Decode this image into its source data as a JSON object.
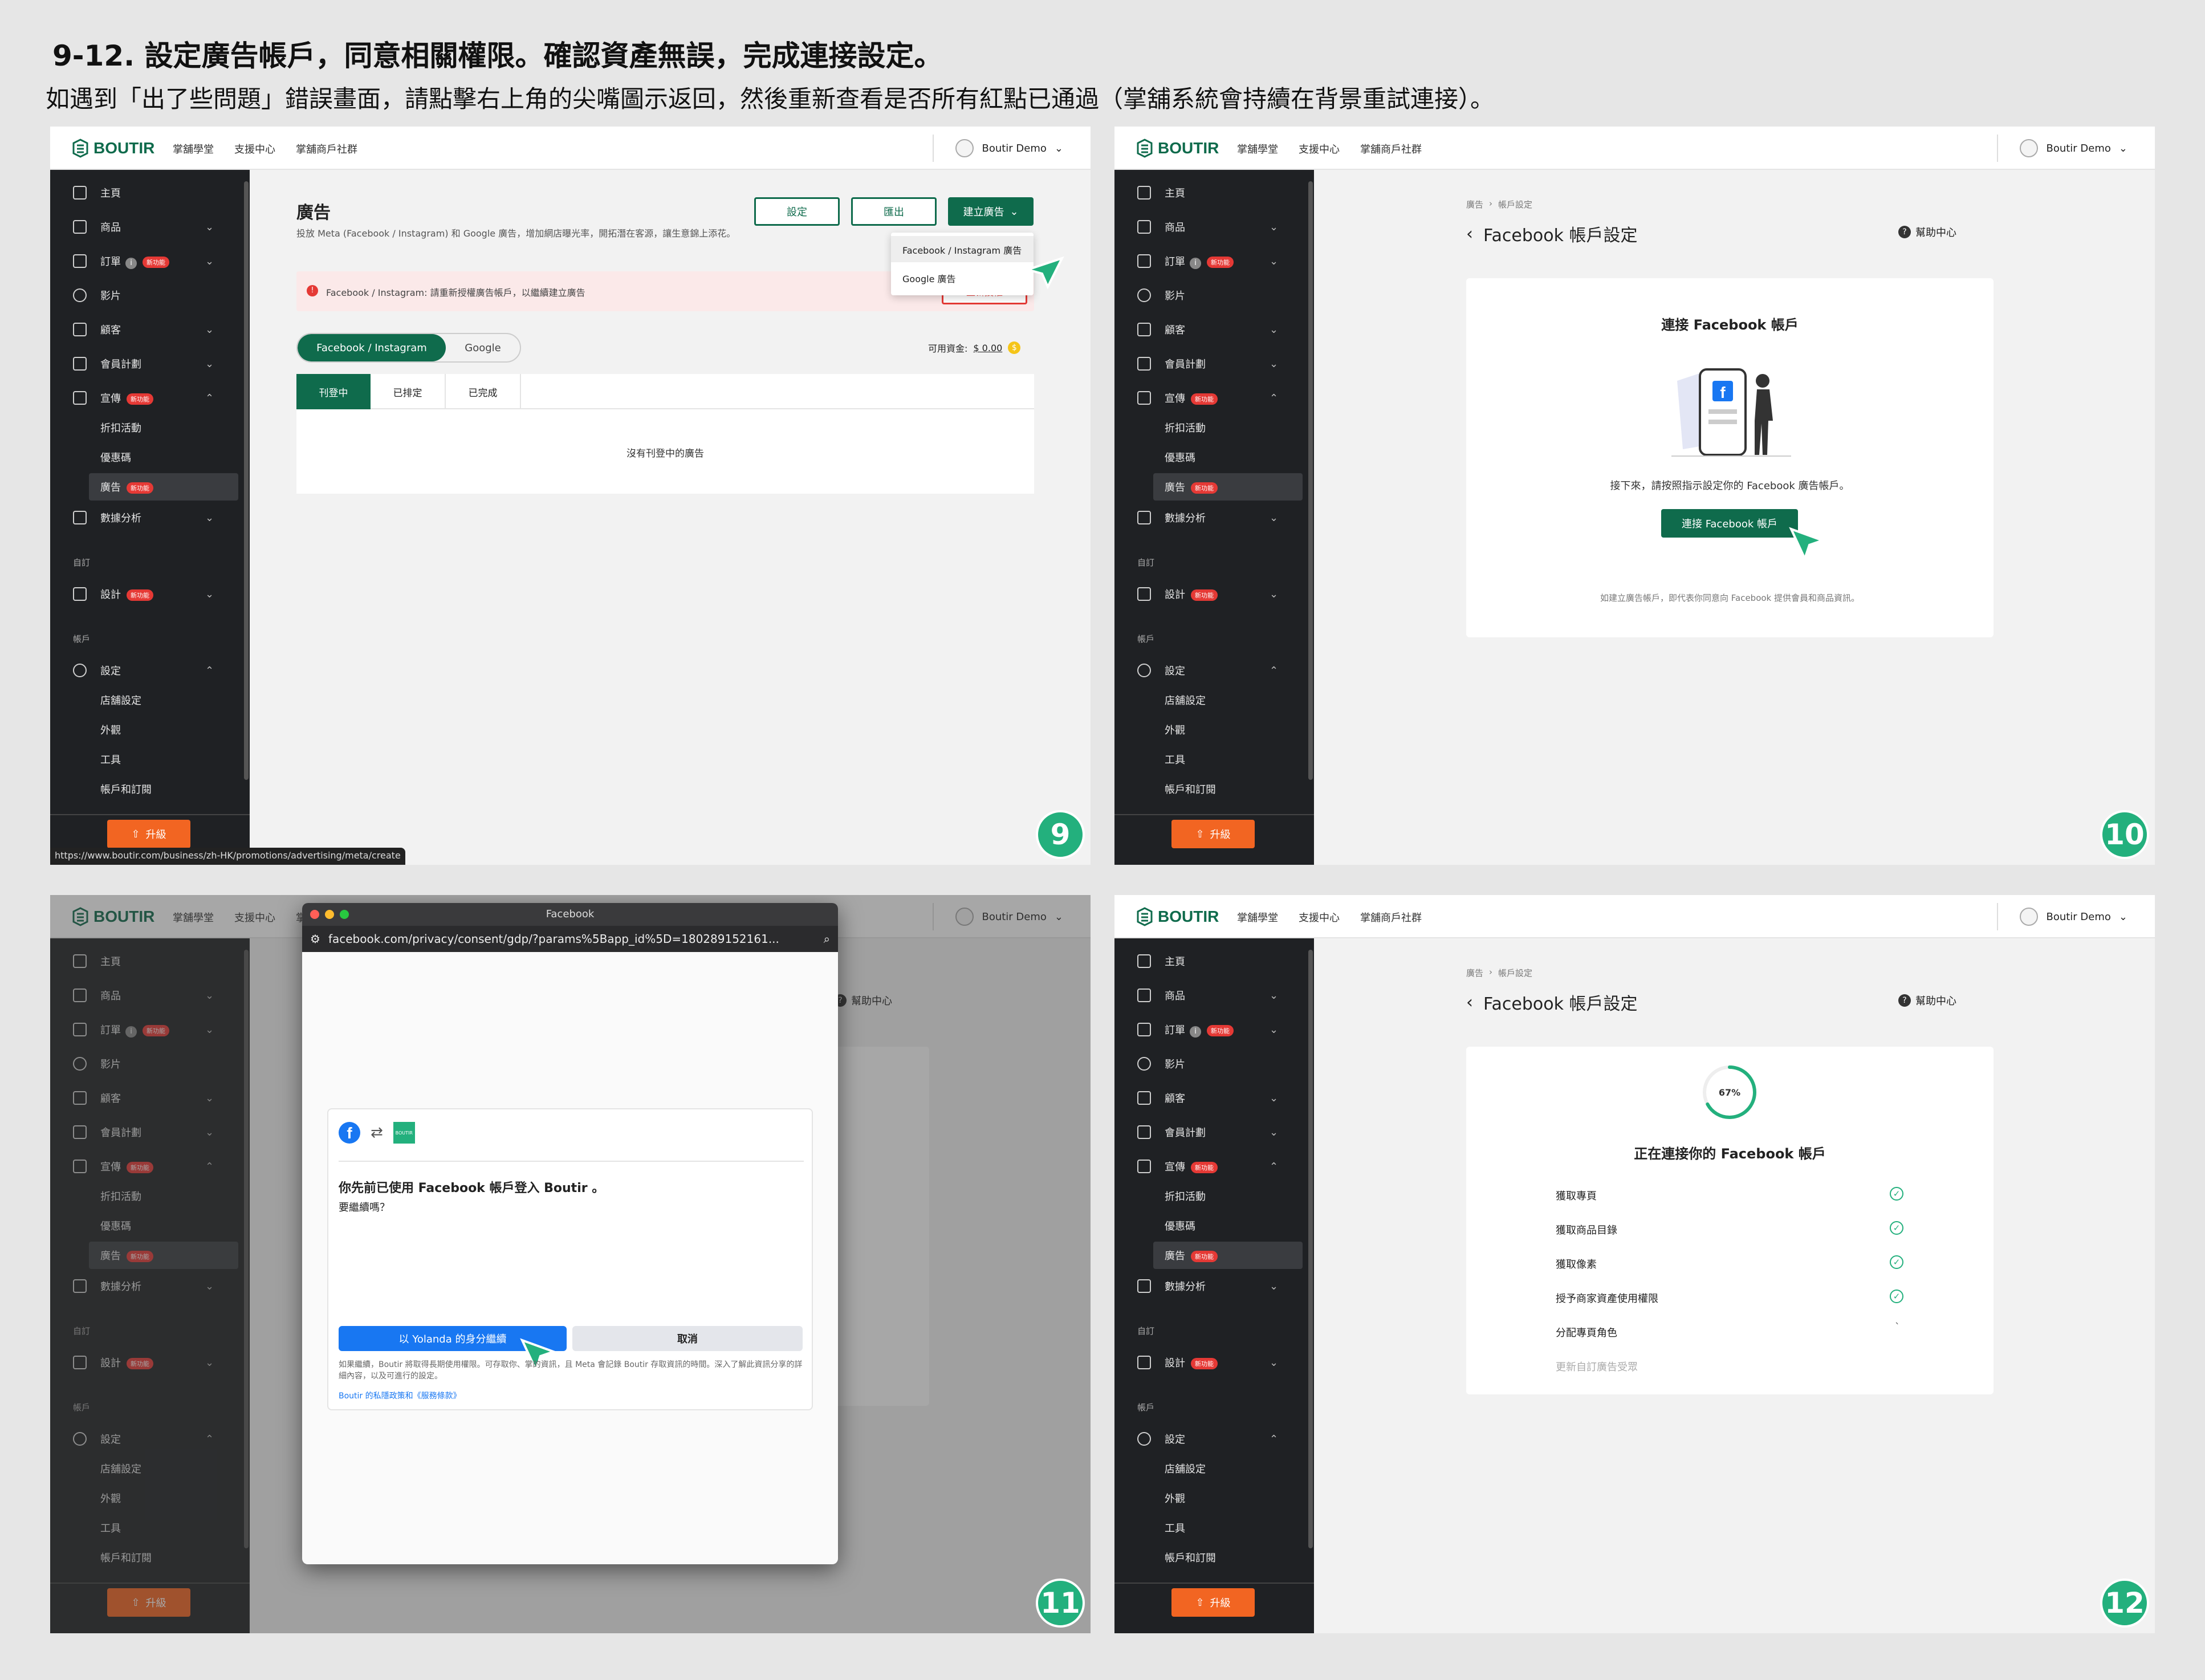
{
  "heading": "9-12. 設定廣告帳戶，同意相關權限。確認資產無誤，完成連接設定。",
  "subheading": "如遇到「出了些問題」錯誤畫面，請點擊右上角的尖嘴圖示返回，然後重新查看是否所有紅點已通過（掌舖系統會持續在背景重試連接）。",
  "topbar": {
    "logo": "BOUTIR",
    "links": [
      "掌舖學堂",
      "支援中心",
      "掌舖商戶社群"
    ],
    "user": "Boutir Demo"
  },
  "sidebar": {
    "items": [
      "主頁",
      "商品",
      "訂單",
      "影片",
      "顧客",
      "會員計劃",
      "宣傳",
      "數據分析",
      "設計",
      "設定"
    ],
    "promo_sub": [
      "折扣活動",
      "優惠碼",
      "廣告"
    ],
    "settings_sub": [
      "店舖設定",
      "外觀",
      "工具",
      "帳戶和訂閱"
    ],
    "section_custom": "自訂",
    "section_account": "帳戶",
    "badge": "新功能",
    "upgrade": "升級"
  },
  "p9": {
    "title": "廣告",
    "desc": "投放 Meta (Facebook / Instagram) 和 Google 廣告，增加網店曝光率，開拓潛在客源，讓生意錦上添花。",
    "btn_settings": "設定",
    "btn_export": "匯出",
    "btn_create": "建立廣告",
    "menu": [
      "Facebook / Instagram 廣告",
      "Google 廣告"
    ],
    "alert": "Facebook / Instagram: 請重新授權廣告帳戶，以繼續建立廣告",
    "alert_btn": "重新授權",
    "tabs": [
      "Facebook / Instagram",
      "Google"
    ],
    "funds_label": "可用資金:",
    "funds_value": "$ 0.00",
    "subtabs": [
      "刊登中",
      "已排定",
      "已完成"
    ],
    "empty": "沒有刊登中的廣告",
    "status_url": "https://www.boutir.com/business/zh-HK/promotions/advertising/meta/create",
    "step": "9"
  },
  "p10": {
    "breadcrumb": [
      "廣告",
      "帳戶設定"
    ],
    "title": "Facebook 帳戶設定",
    "help": "幫助中心",
    "card_title": "連接 Facebook 帳戶",
    "card_text": "接下來，請按照指示設定你的 Facebook 廣告帳戶。",
    "card_btn": "連接 Facebook 帳戶",
    "card_note": "如建立廣告帳戶，即代表你同意向 Facebook 提供會員和商品資訊。",
    "step": "10"
  },
  "p11": {
    "window_title": "Facebook",
    "url": "facebook.com/privacy/consent/gdp/?params%5Bapp_id%5D=180289152161...",
    "logo_small": "BOUTIR",
    "title": "你先前已使用 Facebook 帳戶登入 Boutir 。",
    "question": "要繼續嗎？",
    "continue_btn": "以 Yolanda 的身分繼續",
    "cancel_btn": "取消",
    "note": "如果繼續，Boutir 將取得長期使用權限。可存取你、掌的資訊，且 Meta 會記錄 Boutir 存取資訊的時間。深入了解此資訊分享的詳細內容，以及可進行的設定。",
    "policy": "Boutir 的私隱政策和《服務條款》",
    "help": "幫助中心",
    "step": "11"
  },
  "p12": {
    "breadcrumb": [
      "廣告",
      "帳戶設定"
    ],
    "title": "Facebook 帳戶設定",
    "help": "幫助中心",
    "progress": "67%",
    "progress_value": 0.67,
    "connecting": "正在連接你的 Facebook 帳戶",
    "tasks": [
      "獲取專頁",
      "獲取商品目錄",
      "獲取像素",
      "授予商家資產使用權限",
      "分配專頁角色",
      "更新自訂廣告受眾"
    ],
    "step": "12"
  },
  "colors": {
    "brand": "#0f6b4c",
    "accent": "#23b07d",
    "alert": "#e53935",
    "upgrade": "#f26522",
    "fb": "#1877f2"
  }
}
